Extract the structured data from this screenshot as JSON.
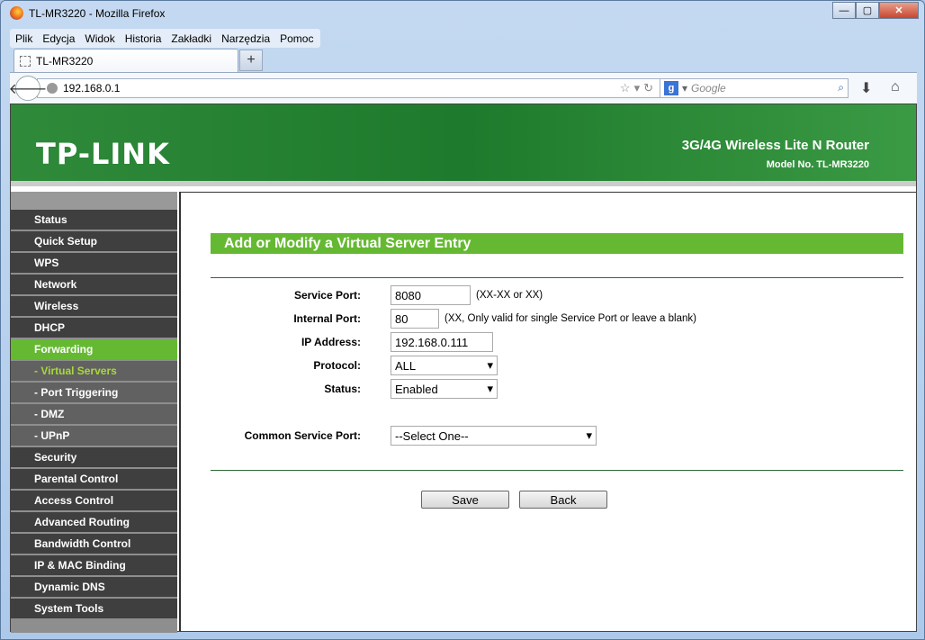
{
  "window": {
    "title": "TL-MR3220 - Mozilla Firefox"
  },
  "menu": [
    "Plik",
    "Edycja",
    "Widok",
    "Historia",
    "Zakładki",
    "Narzędzia",
    "Pomoc"
  ],
  "tab": {
    "label": "TL-MR3220"
  },
  "address": {
    "url": "192.168.0.1"
  },
  "search": {
    "engine": "g",
    "placeholder": "Google"
  },
  "banner": {
    "logo": "TP-LINK",
    "product": "3G/4G Wireless Lite N Router",
    "model": "Model No. TL-MR3220"
  },
  "sidebar": {
    "items": [
      {
        "label": "Status",
        "type": "main"
      },
      {
        "label": "Quick Setup",
        "type": "main"
      },
      {
        "label": "WPS",
        "type": "main"
      },
      {
        "label": "Network",
        "type": "main"
      },
      {
        "label": "Wireless",
        "type": "main"
      },
      {
        "label": "DHCP",
        "type": "main"
      },
      {
        "label": "Forwarding",
        "type": "active"
      },
      {
        "label": "- Virtual Servers",
        "type": "current"
      },
      {
        "label": "- Port Triggering",
        "type": "sub"
      },
      {
        "label": "- DMZ",
        "type": "sub"
      },
      {
        "label": "- UPnP",
        "type": "sub"
      },
      {
        "label": "Security",
        "type": "main"
      },
      {
        "label": "Parental Control",
        "type": "main"
      },
      {
        "label": "Access Control",
        "type": "main"
      },
      {
        "label": "Advanced Routing",
        "type": "main"
      },
      {
        "label": "Bandwidth Control",
        "type": "main"
      },
      {
        "label": "IP & MAC Binding",
        "type": "main"
      },
      {
        "label": "Dynamic DNS",
        "type": "main"
      },
      {
        "label": "System Tools",
        "type": "main"
      }
    ]
  },
  "form": {
    "heading": "Add or Modify a Virtual Server Entry",
    "service_port": {
      "label": "Service Port:",
      "value": "8080",
      "hint": "(XX-XX or XX)"
    },
    "internal_port": {
      "label": "Internal Port:",
      "value": "80",
      "hint": "(XX, Only valid for single Service Port or leave a blank)"
    },
    "ip_address": {
      "label": "IP Address:",
      "value": "192.168.0.111"
    },
    "protocol": {
      "label": "Protocol:",
      "value": "ALL"
    },
    "status": {
      "label": "Status:",
      "value": "Enabled"
    },
    "common_port": {
      "label": "Common Service Port:",
      "value": "--Select One--"
    },
    "save": "Save",
    "back": "Back"
  },
  "colors": {
    "accent_green": "#65b932",
    "banner_green": "#1e7a2c",
    "sidebar_dark": "#3f3f3f"
  }
}
